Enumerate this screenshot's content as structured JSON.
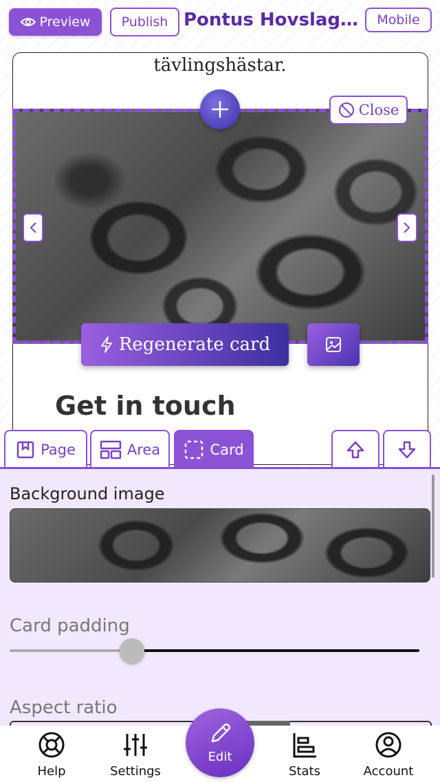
{
  "header": {
    "preview_label": "Preview",
    "publish_label": "Publish",
    "site_title": "Pontus Hovslageri",
    "mobile_label": "Mobile"
  },
  "canvas": {
    "intro_text": "tävlingshästar.",
    "close_label": "Close",
    "regenerate_label": "Regenerate card",
    "heading": "Get in touch"
  },
  "tabs": {
    "page_label": "Page",
    "area_label": "Area",
    "card_label": "Card",
    "active": "Card"
  },
  "panel": {
    "background_image_label": "Background image",
    "card_padding_label": "Card padding",
    "card_padding_value": 0.3,
    "aspect_ratio_label": "Aspect ratio"
  },
  "bottom_nav": {
    "help_label": "Help",
    "settings_label": "Settings",
    "edit_label": "Edit",
    "stats_label": "Stats",
    "account_label": "Account"
  },
  "colors": {
    "accent": "#8b52d6",
    "panel_bg": "#f1e8fd"
  }
}
